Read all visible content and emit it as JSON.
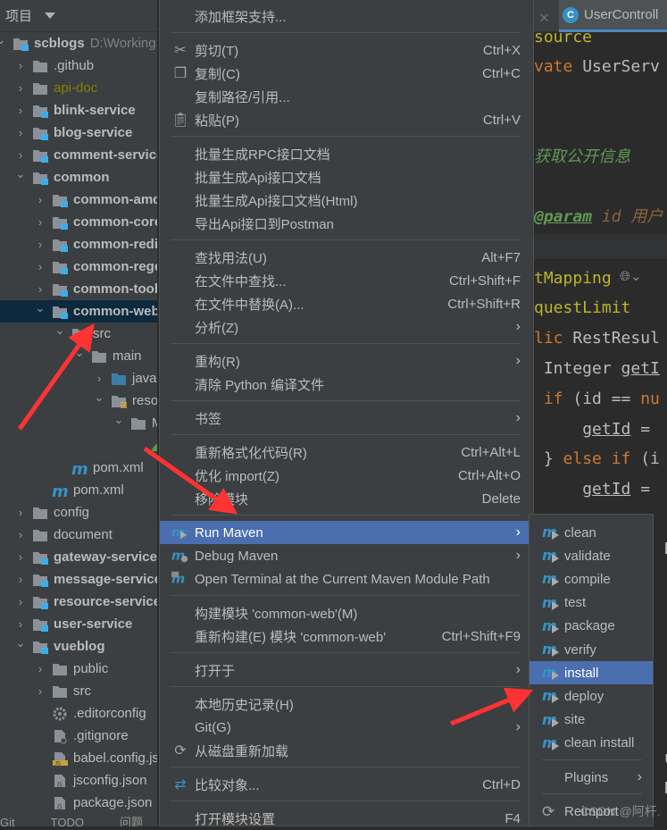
{
  "project_panel": {
    "title": "项目",
    "tree": [
      {
        "label": "scblogs",
        "path": "D:\\WorkingSp",
        "level": 0,
        "icon": "module",
        "bold": true,
        "expanded": true
      },
      {
        "label": ".github",
        "level": 1,
        "icon": "folder",
        "expanded": false
      },
      {
        "label": "api-doc",
        "level": 1,
        "icon": "folder",
        "expanded": false,
        "color": "#808000"
      },
      {
        "label": "blink-service",
        "level": 1,
        "icon": "module",
        "bold": true,
        "expanded": false
      },
      {
        "label": "blog-service",
        "level": 1,
        "icon": "module",
        "bold": true,
        "expanded": false
      },
      {
        "label": "comment-service",
        "level": 1,
        "icon": "module",
        "bold": true,
        "expanded": false
      },
      {
        "label": "common",
        "level": 1,
        "icon": "module",
        "bold": true,
        "expanded": true
      },
      {
        "label": "common-amqp",
        "level": 2,
        "icon": "module",
        "bold": true,
        "expanded": false
      },
      {
        "label": "common-core",
        "level": 2,
        "icon": "module",
        "bold": true,
        "expanded": false
      },
      {
        "label": "common-redis",
        "level": 2,
        "icon": "module",
        "bold": true,
        "expanded": false
      },
      {
        "label": "common-regex",
        "level": 2,
        "icon": "module",
        "bold": true,
        "expanded": false
      },
      {
        "label": "common-tool",
        "level": 2,
        "icon": "module",
        "bold": true,
        "expanded": false
      },
      {
        "label": "common-web",
        "level": 2,
        "icon": "module",
        "bold": true,
        "expanded": true,
        "selected": true
      },
      {
        "label": "src",
        "level": 3,
        "icon": "folder",
        "expanded": true
      },
      {
        "label": "main",
        "level": 4,
        "icon": "folder",
        "expanded": true
      },
      {
        "label": "java",
        "level": 5,
        "icon": "source-folder",
        "expanded": false
      },
      {
        "label": "resources",
        "level": 5,
        "icon": "resources-folder",
        "expanded": true
      },
      {
        "label": "META-INF",
        "level": 6,
        "icon": "folder",
        "expanded": true
      },
      {
        "label": "",
        "level": 7,
        "icon": "spring-leaf"
      },
      {
        "label": "pom.xml",
        "level": 3,
        "icon": "maven"
      },
      {
        "label": "pom.xml",
        "level": 2,
        "icon": "maven"
      },
      {
        "label": "config",
        "level": 1,
        "icon": "folder",
        "expanded": false
      },
      {
        "label": "document",
        "level": 1,
        "icon": "folder",
        "expanded": false
      },
      {
        "label": "gateway-service",
        "level": 1,
        "icon": "module",
        "bold": true,
        "expanded": false
      },
      {
        "label": "message-service",
        "level": 1,
        "icon": "module",
        "bold": true,
        "expanded": false
      },
      {
        "label": "resource-service",
        "level": 1,
        "icon": "module",
        "bold": true,
        "expanded": false
      },
      {
        "label": "user-service",
        "level": 1,
        "icon": "module",
        "bold": true,
        "expanded": false
      },
      {
        "label": "vueblog",
        "level": 1,
        "icon": "module",
        "bold": true,
        "expanded": true
      },
      {
        "label": "public",
        "level": 2,
        "icon": "folder",
        "expanded": false
      },
      {
        "label": "src",
        "level": 2,
        "icon": "folder",
        "expanded": false
      },
      {
        "label": ".editorconfig",
        "level": 2,
        "icon": "gear"
      },
      {
        "label": ".gitignore",
        "level": 2,
        "icon": "gitignore"
      },
      {
        "label": "babel.config.js",
        "level": 2,
        "icon": "js"
      },
      {
        "label": "jsconfig.json",
        "level": 2,
        "icon": "json"
      },
      {
        "label": "package.json",
        "level": 2,
        "icon": "json"
      }
    ],
    "bottom_tabs": [
      "Git",
      "TODO",
      "问题"
    ]
  },
  "editor": {
    "tab_label": "UserControll",
    "tab_icon": "C",
    "lines": [
      {
        "html_parts": [
          {
            "t": "source",
            "c": "ann"
          }
        ],
        "row": 0
      },
      {
        "html_parts": [
          {
            "t": "vate ",
            "c": "kw"
          },
          {
            "t": "UserServ",
            "c": ""
          }
        ],
        "row": 1
      },
      {
        "html_parts": [
          {
            "t": "获取公开信息",
            "c": "cm"
          }
        ],
        "row": 4
      },
      {
        "html_parts": [
          {
            "t": "@param",
            "c": "tag"
          },
          {
            "t": " id 用户",
            "c": "pid"
          }
        ],
        "row": 6
      },
      {
        "html_parts": [
          {
            "t": "tMapping",
            "c": "ann"
          }
        ],
        "row": 8
      },
      {
        "html_parts": [
          {
            "t": "questLimit",
            "c": "ann"
          }
        ],
        "row": 9
      },
      {
        "html_parts": [
          {
            "t": "lic ",
            "c": "kw"
          },
          {
            "t": "RestResul",
            "c": ""
          }
        ],
        "row": 10
      },
      {
        "html_parts": [
          {
            "t": " Integer ",
            "c": ""
          },
          {
            "t": "getI",
            "c": "ul"
          }
        ],
        "row": 11
      },
      {
        "html_parts": [
          {
            "t": " if ",
            "c": "kw"
          },
          {
            "t": "(id == ",
            "c": ""
          },
          {
            "t": "nu",
            "c": "kw"
          }
        ],
        "row": 12
      },
      {
        "html_parts": [
          {
            "t": "     ",
            "c": ""
          },
          {
            "t": "getId",
            "c": "ul"
          },
          {
            "t": " =",
            "c": ""
          }
        ],
        "row": 13
      },
      {
        "html_parts": [
          {
            "t": " } ",
            "c": ""
          },
          {
            "t": "else if ",
            "c": "kw"
          },
          {
            "t": "(i",
            "c": ""
          }
        ],
        "row": 14
      },
      {
        "html_parts": [
          {
            "t": "     ",
            "c": ""
          },
          {
            "t": "getId",
            "c": "ul"
          },
          {
            "t": " =",
            "c": ""
          }
        ],
        "row": 15
      }
    ]
  },
  "context_menu": {
    "items": [
      {
        "label": "添加框架支持..."
      },
      {
        "sep": true
      },
      {
        "label": "剪切(T)",
        "shortcut": "Ctrl+X",
        "icon": "scissors"
      },
      {
        "label": "复制(C)",
        "shortcut": "Ctrl+C",
        "icon": "copy"
      },
      {
        "label": "复制路径/引用..."
      },
      {
        "label": "粘贴(P)",
        "shortcut": "Ctrl+V",
        "icon": "clipboard"
      },
      {
        "sep": true
      },
      {
        "label": "批量生成RPC接口文档"
      },
      {
        "label": "批量生成Api接口文档"
      },
      {
        "label": "批量生成Api接口文档(Html)"
      },
      {
        "label": "导出Api接口到Postman"
      },
      {
        "sep": true
      },
      {
        "label": "查找用法(U)",
        "shortcut": "Alt+F7"
      },
      {
        "label": "在文件中查找...",
        "shortcut": "Ctrl+Shift+F"
      },
      {
        "label": "在文件中替换(A)...",
        "shortcut": "Ctrl+Shift+R"
      },
      {
        "label": "分析(Z)",
        "submenu": true
      },
      {
        "sep": true
      },
      {
        "label": "重构(R)",
        "submenu": true
      },
      {
        "label": "清除 Python 编译文件"
      },
      {
        "sep": true
      },
      {
        "label": "书签",
        "submenu": true
      },
      {
        "sep": true
      },
      {
        "label": "重新格式化代码(R)",
        "shortcut": "Ctrl+Alt+L"
      },
      {
        "label": "优化 import(Z)",
        "shortcut": "Ctrl+Alt+O"
      },
      {
        "label": "移除模块",
        "shortcut": "Delete"
      },
      {
        "sep": true
      },
      {
        "label": "Run Maven",
        "submenu": true,
        "icon": "maven-run",
        "highlighted": true
      },
      {
        "label": "Debug Maven",
        "submenu": true,
        "icon": "maven-debug"
      },
      {
        "label": "Open Terminal at the Current Maven Module Path",
        "icon": "maven-terminal"
      },
      {
        "sep": true
      },
      {
        "label": "构建模块 'common-web'(M)"
      },
      {
        "label": "重新构建(E) 模块 'common-web'",
        "shortcut": "Ctrl+Shift+F9"
      },
      {
        "sep": true
      },
      {
        "label": "打开于",
        "submenu": true
      },
      {
        "sep": true
      },
      {
        "label": "本地历史记录(H)",
        "submenu": true
      },
      {
        "label": "Git(G)",
        "submenu": true
      },
      {
        "label": "从磁盘重新加载",
        "icon": "reload"
      },
      {
        "sep": true
      },
      {
        "label": "比较对象...",
        "shortcut": "Ctrl+D",
        "icon": "compare"
      },
      {
        "sep": true
      },
      {
        "label": "打开模块设置",
        "shortcut": "F4"
      }
    ]
  },
  "maven_submenu": {
    "items": [
      {
        "label": "clean"
      },
      {
        "label": "validate"
      },
      {
        "label": "compile"
      },
      {
        "label": "test"
      },
      {
        "label": "package"
      },
      {
        "label": "verify"
      },
      {
        "label": "install",
        "highlighted": true
      },
      {
        "label": "deploy"
      },
      {
        "label": "site"
      },
      {
        "label": "clean install"
      },
      {
        "sep": true
      },
      {
        "label": "Plugins",
        "submenu": true,
        "noicon": true
      },
      {
        "sep": true
      },
      {
        "label": "Reimport",
        "icon": "reload"
      }
    ]
  },
  "watermark": "CSDN @阿杆.",
  "colors": {
    "selection": "#4b6eaf",
    "tree_selection": "#0d293e",
    "arrow": "#ff3333",
    "module_badge": "#3dadea"
  }
}
